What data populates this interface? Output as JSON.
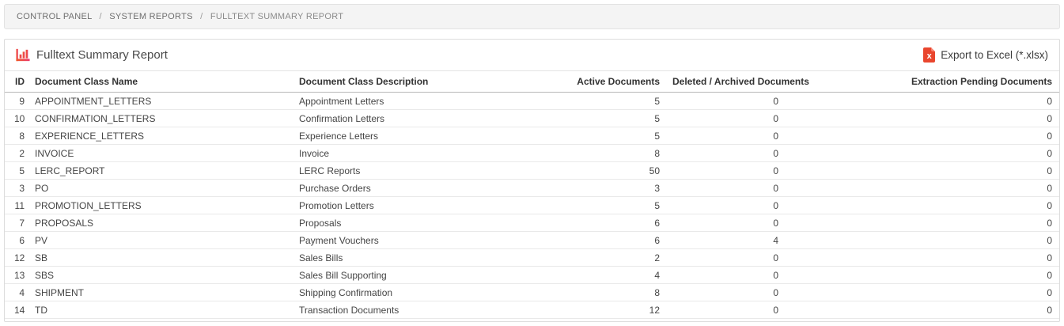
{
  "breadcrumb": {
    "separator": "/",
    "items": [
      {
        "label": "CONTROL PANEL"
      },
      {
        "label": "SYSTEM REPORTS"
      },
      {
        "label": "FULLTEXT SUMMARY REPORT"
      }
    ]
  },
  "panel": {
    "title": "Fulltext Summary Report",
    "export_label": "Export to Excel (*.xlsx)",
    "excel_icon_letter": "x",
    "title_icon": "bar-chart-icon",
    "accent_color": "#e9462e"
  },
  "table": {
    "columns": [
      "ID",
      "Document Class Name",
      "Document Class Description",
      "Active Documents",
      "Deleted / Archived Documents",
      "Extraction Pending Documents"
    ],
    "rows": [
      [
        9,
        "APPOINTMENT_LETTERS",
        "Appointment Letters",
        5,
        0,
        0
      ],
      [
        10,
        "CONFIRMATION_LETTERS",
        "Confirmation Letters",
        5,
        0,
        0
      ],
      [
        8,
        "EXPERIENCE_LETTERS",
        "Experience Letters",
        5,
        0,
        0
      ],
      [
        2,
        "INVOICE",
        "Invoice",
        8,
        0,
        0
      ],
      [
        5,
        "LERC_REPORT",
        "LERC Reports",
        50,
        0,
        0
      ],
      [
        3,
        "PO",
        "Purchase Orders",
        3,
        0,
        0
      ],
      [
        11,
        "PROMOTION_LETTERS",
        "Promotion Letters",
        5,
        0,
        0
      ],
      [
        7,
        "PROPOSALS",
        "Proposals",
        6,
        0,
        0
      ],
      [
        6,
        "PV",
        "Payment Vouchers",
        6,
        4,
        0
      ],
      [
        12,
        "SB",
        "Sales Bills",
        2,
        0,
        0
      ],
      [
        13,
        "SBS",
        "Sales Bill Supporting",
        4,
        0,
        0
      ],
      [
        4,
        "SHIPMENT",
        "Shipping Confirmation",
        8,
        0,
        0
      ],
      [
        14,
        "TD",
        "Transaction Documents",
        12,
        0,
        0
      ]
    ]
  }
}
